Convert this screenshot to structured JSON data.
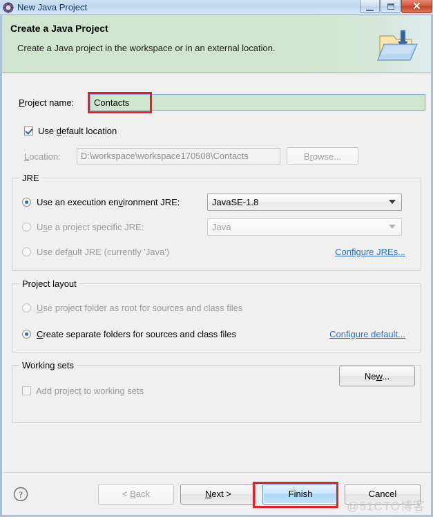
{
  "window": {
    "title": "New Java Project",
    "icon": "eclipse-wizard-icon",
    "controls": {
      "minimize": "Minimize",
      "maximize": "Maximize",
      "close": "✕"
    }
  },
  "header": {
    "title": "Create a Java Project",
    "subtitle": "Create a Java project in the workspace or in an external location.",
    "icon": "java-project-folder-icon"
  },
  "form": {
    "project_name": {
      "label": "Project name:",
      "value": "Contacts",
      "placeholder": "",
      "highlight_color": "#ee1c25",
      "valid_bg": "#cfe5cd"
    },
    "use_default_location": {
      "label": "Use default location",
      "checked": true
    },
    "location": {
      "label": "Location:",
      "value": "D:\\workspace\\workspace170508\\Contacts",
      "disabled": true,
      "browse_label": "Browse..."
    }
  },
  "jre_group": {
    "title": "JRE",
    "option_execution_env": {
      "label": "Use an execution environment JRE:",
      "selected": true,
      "combo_value": "JavaSE-1.8"
    },
    "option_project_specific": {
      "label": "Use a project specific JRE:",
      "selected": false,
      "combo_value": "Java",
      "disabled": true
    },
    "option_default_jre": {
      "label": "Use default JRE (currently 'Java')",
      "selected": false
    },
    "configure_link": "Configure JREs..."
  },
  "layout_group": {
    "title": "Project layout",
    "option_project_folder": {
      "label": "Use project folder as root for sources and class files",
      "selected": false,
      "disabled": true
    },
    "option_separate_folders": {
      "label": "Create separate folders for sources and class files",
      "selected": true
    },
    "configure_link": "Configure default..."
  },
  "working_sets_group": {
    "title": "Working sets",
    "add_to_working_sets": {
      "label": "Add project to working sets",
      "checked": false
    },
    "new_button": "New..."
  },
  "buttonbar": {
    "help_icon": "question-mark-icon",
    "back": "< Back",
    "back_disabled": true,
    "next": "Next >",
    "finish": "Finish",
    "finish_is_default": true,
    "cancel": "Cancel",
    "finish_highlight_color": "#ee1c25"
  },
  "watermark": "@51CTO博客"
}
